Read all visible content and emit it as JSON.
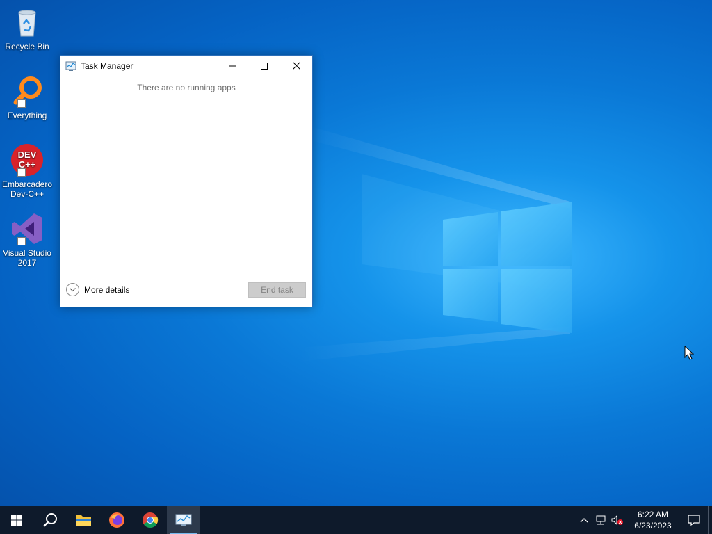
{
  "desktop": {
    "icons": [
      {
        "label": "Recycle Bin",
        "icon": "recycle-bin-icon"
      },
      {
        "label": "Everything",
        "icon": "everything-search-icon"
      },
      {
        "label": "Embarcadero Dev-C++",
        "icon": "devcpp-icon",
        "glyph_text": "DEV C++"
      },
      {
        "label": "Visual Studio 2017",
        "icon": "visual-studio-icon"
      }
    ]
  },
  "task_manager": {
    "title": "Task Manager",
    "empty_message": "There are no running apps",
    "more_details_label": "More details",
    "end_task_label": "End task",
    "end_task_enabled": false
  },
  "taskbar": {
    "apps": [
      {
        "name": "start",
        "icon": "windows-logo-icon"
      },
      {
        "name": "search",
        "icon": "search-icon"
      },
      {
        "name": "file-explorer",
        "icon": "folder-icon"
      },
      {
        "name": "firefox",
        "icon": "firefox-icon"
      },
      {
        "name": "chrome",
        "icon": "chrome-icon"
      },
      {
        "name": "task-manager",
        "icon": "task-manager-icon",
        "active": true
      }
    ],
    "tray": {
      "time": "6:22 AM",
      "date": "6/23/2023",
      "icons": [
        "chevron-up-icon",
        "network-icon",
        "volume-muted-icon",
        "notification-icon"
      ]
    }
  },
  "colors": {
    "desktop_accent": "#0a78d6",
    "taskbar_bg": "#0e1a2b",
    "active_indicator": "#76b9ed",
    "window_border": "#2a6db8"
  }
}
